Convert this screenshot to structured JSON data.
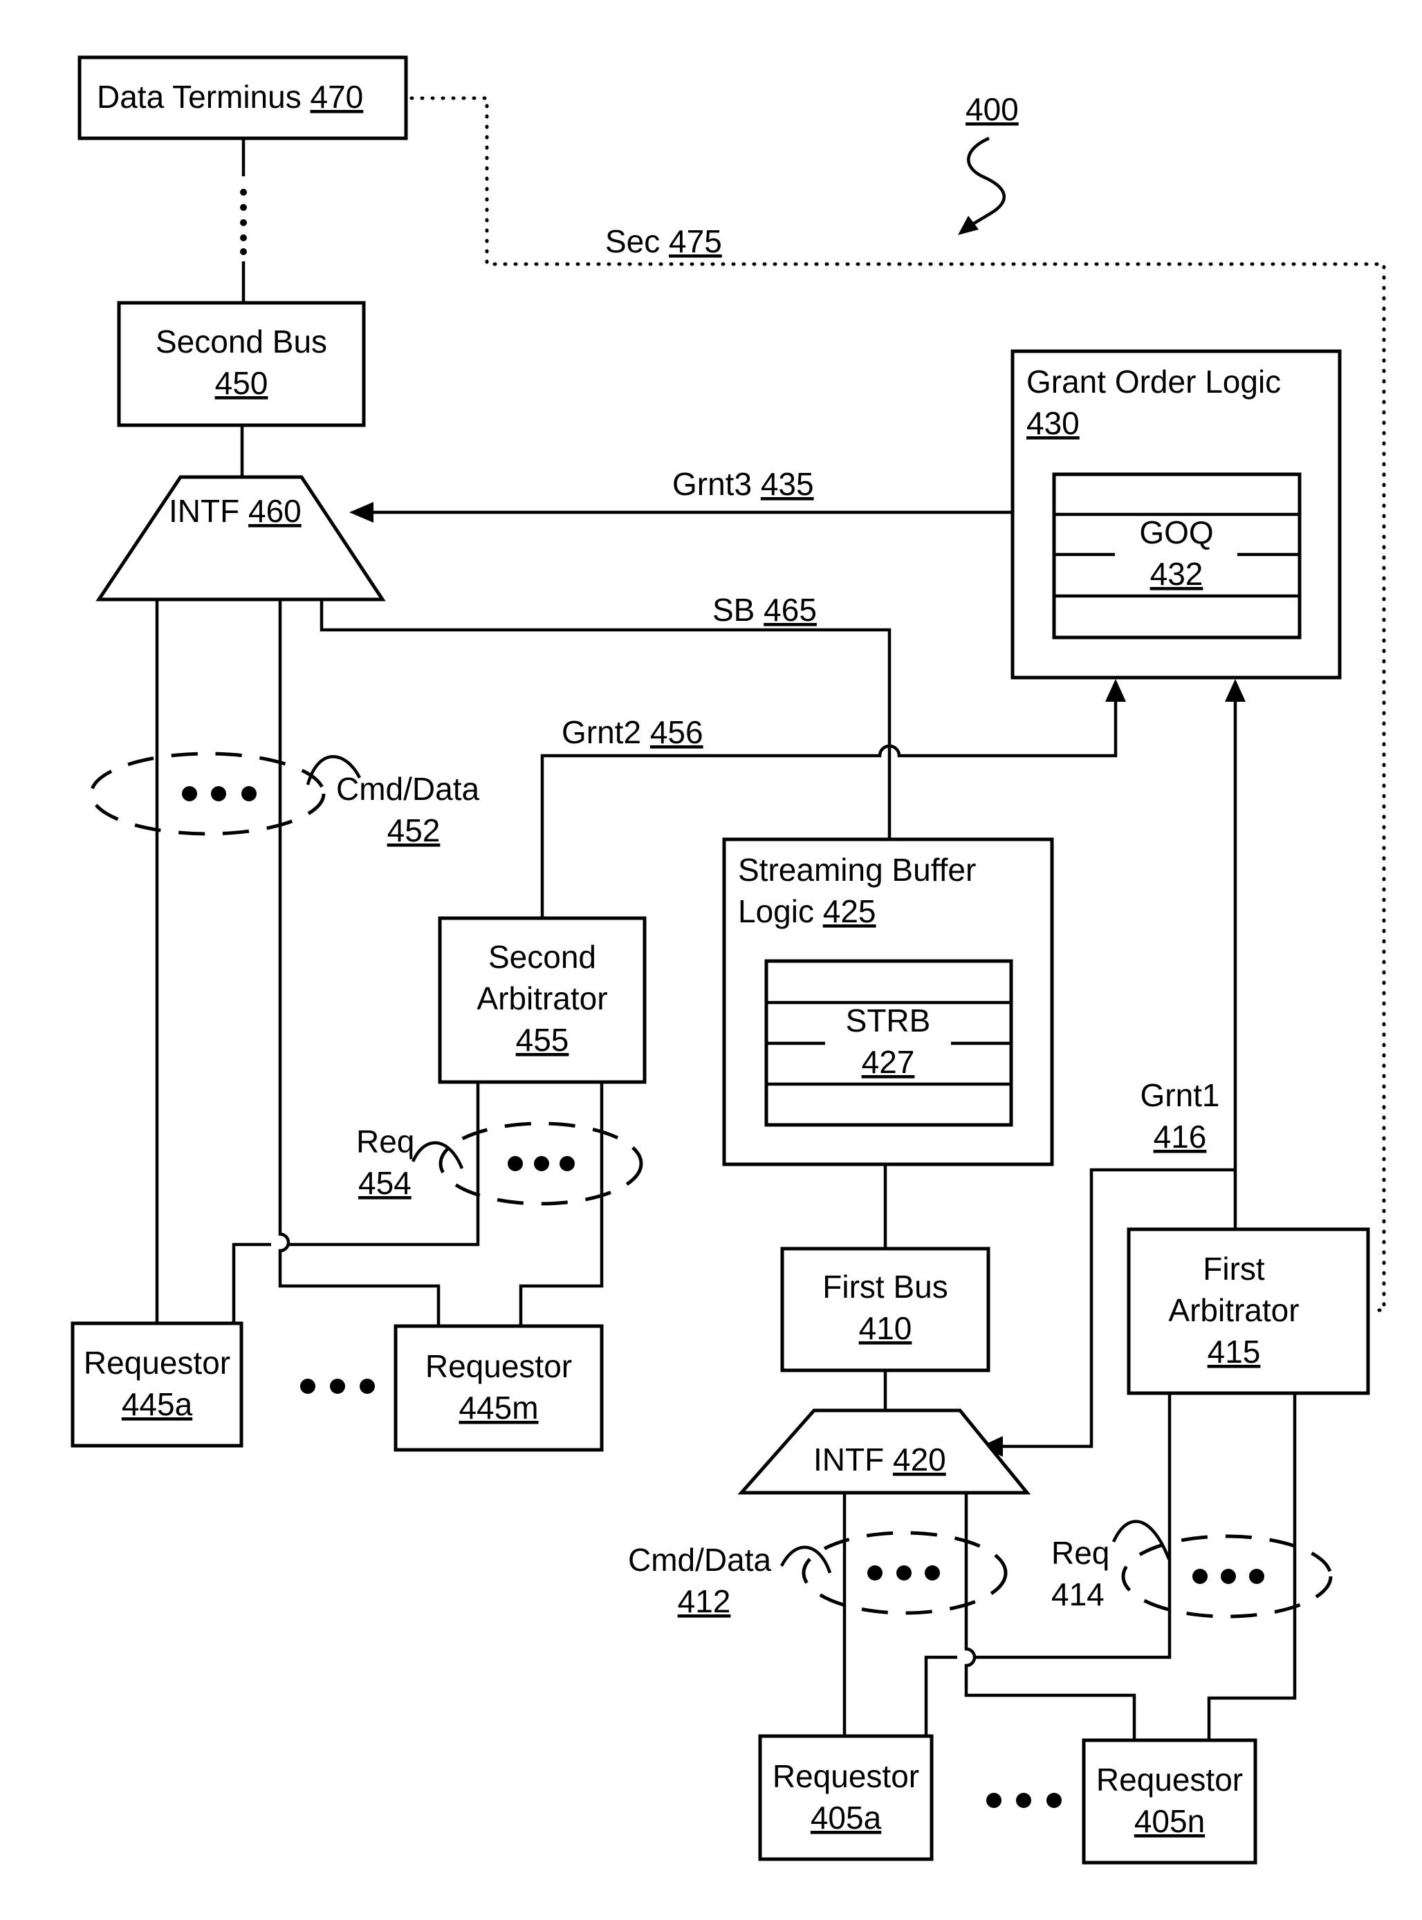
{
  "figure": {
    "ref": "400",
    "components": {
      "data_terminus": {
        "label": "Data Terminus",
        "ref": "470"
      },
      "second_bus": {
        "label": "Second Bus",
        "ref": "450"
      },
      "intf_460": {
        "label": "INTF",
        "ref": "460"
      },
      "grant_order_logic": {
        "label": "Grant Order Logic",
        "ref": "430"
      },
      "goq": {
        "label": "GOQ",
        "ref": "432"
      },
      "streaming_buffer_logic": {
        "label_line1": "Streaming Buffer",
        "label_line2": "Logic",
        "ref": "425"
      },
      "strb": {
        "label": "STRB",
        "ref": "427"
      },
      "second_arbitrator": {
        "label_line1": "Second",
        "label_line2": "Arbitrator",
        "ref": "455"
      },
      "first_bus": {
        "label": "First Bus",
        "ref": "410"
      },
      "first_arbitrator": {
        "label_line1": "First",
        "label_line2": "Arbitrator",
        "ref": "415"
      },
      "intf_420": {
        "label": "INTF",
        "ref": "420"
      },
      "requestor_445a": {
        "label": "Requestor",
        "ref": "445a"
      },
      "requestor_445m": {
        "label": "Requestor",
        "ref": "445m"
      },
      "requestor_405a": {
        "label": "Requestor",
        "ref": "405a"
      },
      "requestor_405n": {
        "label": "Requestor",
        "ref": "405n"
      }
    },
    "signals": {
      "sec": {
        "label": "Sec",
        "ref": "475"
      },
      "grnt3": {
        "label": "Grnt3",
        "ref": "435"
      },
      "sb": {
        "label": "SB",
        "ref": "465"
      },
      "grnt2": {
        "label": "Grnt2",
        "ref": "456"
      },
      "grnt1": {
        "label": "Grnt1",
        "ref": "416"
      },
      "cmd_data_452": {
        "label": "Cmd/Data",
        "ref": "452"
      },
      "req_454": {
        "label": "Req",
        "ref": "454"
      },
      "cmd_data_412": {
        "label": "Cmd/Data",
        "ref": "412"
      },
      "req_414": {
        "label": "Req",
        "ref": "414"
      }
    }
  }
}
